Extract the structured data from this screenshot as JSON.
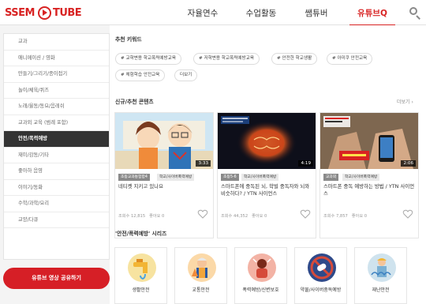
{
  "header": {
    "logo_left": "SSEM",
    "logo_right": "TUBE",
    "nav": [
      "자율연수",
      "수업활동",
      "쌤튜버",
      "유튜브Q"
    ],
    "active_nav_index": 3
  },
  "sidebar": {
    "items": [
      "교과",
      "애니메이션 / 영화",
      "만들기/그리기/종이접기",
      "놀이/체육/퀴즈",
      "노래/율동/동요/음레쉬",
      "교과외 교육 (범례 포함)",
      "안전/폭력예방",
      "재미/감동/기타",
      "좋아하 음영",
      "이야기/동화",
      "수학/과학/요리",
      "교양/다큐"
    ],
    "active_index": 6,
    "share_button": "유튜브 영상 공유하기"
  },
  "keywords": {
    "title": "추천 키워드",
    "chips": [
      "# 교학변용 학교폭력예방교육",
      "# 저학변용 학교폭력예방교육",
      "# 안전한 학교생활",
      "# 아미쿠 안전교육",
      "# 체험학습 안전교육",
      "더보기"
    ]
  },
  "new_videos": {
    "title": "신규/추천 콘텐츠",
    "more": "더보기 ›",
    "cards": [
      {
        "duration": "3:33",
        "tags": [
          "초등교과통합합4",
          "학교/사이버폭력예방"
        ],
        "title": "네티켓 지키고 있나요",
        "views": "조회수 12,815",
        "likes": "좋아요 0"
      },
      {
        "duration": "4:19",
        "tags": [
          "초등5-6",
          "학교/사이버폭력예방"
        ],
        "title": "스마트폰에 중독된 뇌, 학벌 중독자와 뇌와 비슷하다? / YTN 사이언스",
        "views": "조회수 44,352",
        "likes": "좋아요 0"
      },
      {
        "duration": "2:06",
        "tags": [
          "교과외",
          "학교/사이버폭력예방"
        ],
        "title": "스마트폰 중독 예방하는 방법 / YTN 사이언스",
        "views": "조회수 7,857",
        "likes": "좋아요 0"
      }
    ]
  },
  "series": {
    "title": "'안전/폭력예방' 시리즈",
    "items": [
      {
        "label": "생활안전",
        "icon": "faucet-icon"
      },
      {
        "label": "교통안전",
        "icon": "traffic-safety-icon"
      },
      {
        "label": "폭력예방/신변보호",
        "icon": "violence-prevention-icon"
      },
      {
        "label": "약물/사이버중독예방",
        "icon": "drug-prevention-icon"
      },
      {
        "label": "재난안전",
        "icon": "disaster-safety-icon"
      }
    ]
  },
  "colors": {
    "brand_red": "#d82323",
    "active_sidebar": "#333333",
    "share_button": "#d61f26"
  }
}
